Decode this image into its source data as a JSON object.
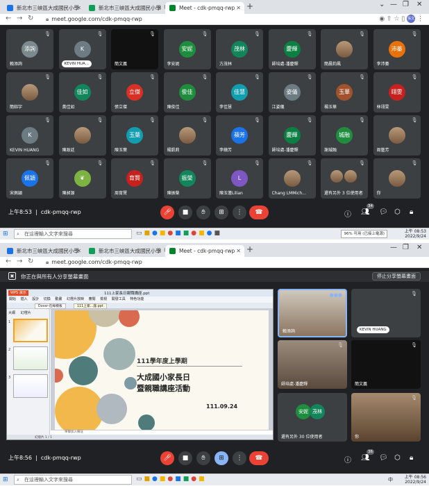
{
  "browser": {
    "tabs": [
      {
        "title": "新北市三峽區大成國民小學"
      },
      {
        "title": "新北市三峽區大成國民小學「親"
      },
      {
        "title": "Meet - cdk-pmqq-rwp"
      }
    ],
    "url": "meet.google.com/cdk-pmqq-rwp",
    "profile": "張文"
  },
  "meeting": {
    "code": "cdk-pmqq-rwp",
    "shot1_time": "上午8:53",
    "shot2_time": "上午8:56",
    "shot1_people_count": "34",
    "shot2_people_count": "36"
  },
  "grid": {
    "tiles": [
      {
        "initials": "添詢",
        "name": "賴添詢",
        "color": "#7b8a8e"
      },
      {
        "initials": "K",
        "name": "KEVIN HUA...",
        "color": "#6d7b83",
        "chip": true
      },
      {
        "initials": "",
        "name": "簡文義",
        "dark": true
      },
      {
        "initials": "安妮",
        "name": "李安妮",
        "color": "#1e8e3e"
      },
      {
        "initials": "茂林",
        "name": "方茂林",
        "color": "#12855b"
      },
      {
        "initials": "慶輝",
        "name": "師培處-潘慶輝",
        "color": "#0b8043"
      },
      {
        "initials": "",
        "name": "簡晨鈞鳳",
        "photo": true
      },
      {
        "initials": "沛蓁",
        "name": "李沛蓁",
        "color": "#e8710a"
      },
      {
        "initials": "",
        "name": "簡鈺宇",
        "photo": true
      },
      {
        "initials": "佳如",
        "name": "黃佳如",
        "color": "#12855b"
      },
      {
        "initials": "立傑",
        "name": "張立傑",
        "color": "#d93025"
      },
      {
        "initials": "俊佳",
        "name": "陳俊佳",
        "color": "#1e8e3e"
      },
      {
        "initials": "佳慧",
        "name": "李佳慧",
        "color": "#129eaf"
      },
      {
        "initials": "姿儀",
        "name": "江姿儀",
        "color": "#6d7b83"
      },
      {
        "initials": "玉華",
        "name": "楊玉華",
        "color": "#a0522d"
      },
      {
        "initials": "翊雯",
        "name": "林翊雯",
        "color": "#c5221f"
      },
      {
        "initials": "K",
        "name": "KEVIN HUANG",
        "color": "#6d7b83"
      },
      {
        "initials": "",
        "name": "陳政廷",
        "photo": true
      },
      {
        "initials": "玉葉",
        "name": "陳玉葉",
        "color": "#129eaf"
      },
      {
        "initials": "",
        "name": "楊凱莉",
        "photo": true
      },
      {
        "initials": "蘋芳",
        "name": "李蘋芳",
        "color": "#1a73e8"
      },
      {
        "initials": "慶輝",
        "name": "師培處-潘慶輝",
        "color": "#0b8043"
      },
      {
        "initials": "城融",
        "name": "謝城融",
        "color": "#1e8e3e"
      },
      {
        "initials": "",
        "name": "周藝芳",
        "photo": true
      },
      {
        "initials": "佩穎",
        "name": "宋佩穎",
        "color": "#1a73e8"
      },
      {
        "initials": "",
        "name": "陳昶源",
        "leaf": true
      },
      {
        "initials": "育賢",
        "name": "周育賢",
        "color": "#c5221f"
      },
      {
        "initials": "振榮",
        "name": "陳振榮",
        "color": "#12855b"
      },
      {
        "initials": "L",
        "name": "陳玉蓮Lilian",
        "color": "#7e57c2"
      },
      {
        "initials": "",
        "name": "Chang LMMich...",
        "photo": true
      },
      {
        "initials": "",
        "name": "還有另外 3 位使用者",
        "more": true
      },
      {
        "initials": "",
        "name": "你",
        "photo": true
      }
    ]
  },
  "taskbar": {
    "search_placeholder": "在這裡輸入文字來搜尋",
    "battery_text": "96% 可用 (已接上電源)",
    "clock_time_1": "上午 08:53",
    "clock_time_2": "上午 08:56",
    "clock_date": "2022/9/24",
    "ime": "中"
  },
  "presenting": {
    "banner_text": "你正在與所有人分享螢幕畫面",
    "stop_label": "停止分享螢幕畫面"
  },
  "wps": {
    "app_label": "WPS 演示",
    "file_title": "111上家長日親職講座.ppt",
    "menu": [
      "開始",
      "插入",
      "設計",
      "切換",
      "動畫",
      "幻燈片放映",
      "審閱",
      "檢視",
      "開發工具",
      "特色功能"
    ],
    "doc_tabs": [
      "Docer-在線模板",
      "111上家...座.ppt"
    ],
    "panel_tabs": [
      "大綱",
      "幻燈片"
    ],
    "notes_placeholder": "單擊加入備註",
    "status_text": "幻燈片 1 / 1"
  },
  "slide": {
    "year_line": "111學年度上學期",
    "title_line1": "大成國小家長日",
    "title_line2": "暨親職講座活動",
    "date": "111.09.24"
  },
  "side_tiles": [
    {
      "name": "賴添詢"
    },
    {
      "name": "KEVIN HUANG"
    },
    {
      "name": "師培處-潘慶輝"
    },
    {
      "name": "簡文義"
    },
    {
      "name": "還有另外 30 位使用者",
      "a1": "安妮",
      "a2": "茂林"
    },
    {
      "name": "你"
    }
  ],
  "colors": {
    "meet_bg": "#202124",
    "tile_bg": "#3c4043",
    "end_call": "#ea4335",
    "present_active": "#8ab4f8"
  }
}
